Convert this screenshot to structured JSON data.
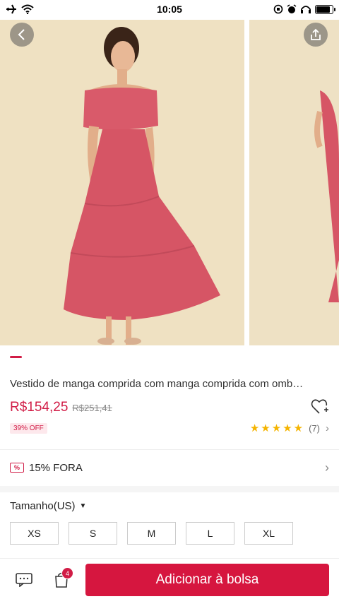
{
  "status_bar": {
    "time": "10:05"
  },
  "gallery": {
    "images": [
      "off-shoulder pink tiered maxi dress front view",
      "same dress side view (partial)"
    ],
    "active_index": 0
  },
  "product": {
    "title": "Vestido de manga comprida com manga comprida com omb…",
    "price": "R$154,25",
    "original_price": "R$251,41",
    "discount": "39% OFF",
    "rating": {
      "stars": 5,
      "count_label": "(7)"
    }
  },
  "promo": {
    "label": "15% FORA",
    "icon": "percent-coupon-icon",
    "icon_glyph": "%"
  },
  "size_selector": {
    "label": "Tamanho(US)",
    "options": [
      "XS",
      "S",
      "M",
      "L",
      "XL"
    ]
  },
  "bottom_bar": {
    "cart_count": "4",
    "add_label": "Adicionar à bolsa"
  },
  "colors": {
    "accent": "#d11c46",
    "dress": "#d95a6a",
    "backdrop": "#efe1c2"
  }
}
